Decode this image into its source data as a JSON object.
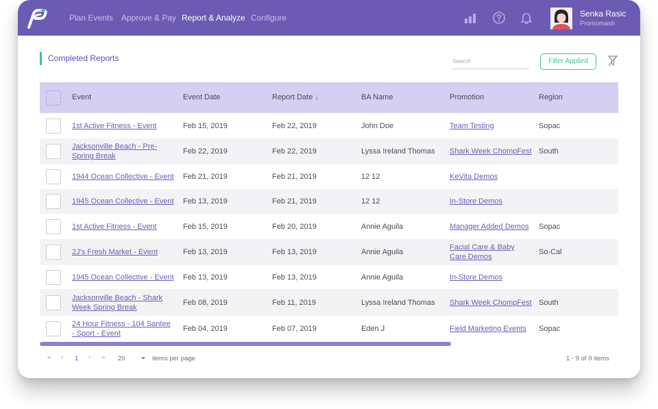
{
  "app": {
    "brand_color": "#6c5bb3",
    "accent_color": "#3cc48e",
    "nav": [
      "Plan Events",
      "Approve & Pay",
      "Report & Analyze",
      "Configure"
    ],
    "active_nav": "Report & Analyze",
    "user": {
      "name": "Senka Rasic",
      "org": "Promomash"
    },
    "icons": [
      "bar-chart-icon",
      "help-icon",
      "bell-icon"
    ]
  },
  "page": {
    "title": "Completed Reports",
    "search_placeholder": "Search",
    "filter_button": "Filter Applied"
  },
  "table": {
    "columns": [
      "Event",
      "Event Date",
      "Report Date",
      "BA Name",
      "Promotion",
      "Region"
    ],
    "sort_indicator": "↓",
    "rows": [
      {
        "event": "1st Active Fitness - Event",
        "event_date": "Feb 15, 2019",
        "report_date": "Feb 22, 2019",
        "ba_name": "John Doe",
        "promotion": "Team Testing",
        "region": "Sopac"
      },
      {
        "event": "Jacksonville Beach - Pre-Spring Break",
        "event_date": "Feb 22, 2019",
        "report_date": "Feb 22, 2019",
        "ba_name": "Lyssa Ireland Thomas",
        "promotion": "Shark Week ChompFest",
        "region": "South"
      },
      {
        "event": "1944 Ocean Collective - Event",
        "event_date": "Feb 21, 2019",
        "report_date": "Feb 21, 2019",
        "ba_name": "12 12",
        "promotion": "KeVita Demos",
        "region": ""
      },
      {
        "event": "1945 Ocean Collective - Event",
        "event_date": "Feb 13, 2019",
        "report_date": "Feb 21, 2019",
        "ba_name": "12 12",
        "promotion": "In-Store Demos",
        "region": ""
      },
      {
        "event": "1st Active Fitness - Event",
        "event_date": "Feb 15, 2019",
        "report_date": "Feb 20, 2019",
        "ba_name": "Annie Aguila",
        "promotion": "Manager Added Demos",
        "region": "Sopac"
      },
      {
        "event": "2J's Fresh Market - Event",
        "event_date": "Feb 13, 2019",
        "report_date": "Feb 13, 2019",
        "ba_name": "Annie Aguila",
        "promotion": "Facial Care & Baby Care Demos",
        "region": "So-Cal"
      },
      {
        "event": "1945 Ocean Collective - Event",
        "event_date": "Feb 13, 2019",
        "report_date": "Feb 13, 2019",
        "ba_name": "Annie Aguila",
        "promotion": "In-Store Demos",
        "region": ""
      },
      {
        "event": "Jacksonville Beach - Shark Week Spring Break",
        "event_date": "Feb 08, 2019",
        "report_date": "Feb 11, 2019",
        "ba_name": "Lyssa Ireland Thomas",
        "promotion": "Shark Week ChompFest",
        "region": "South"
      },
      {
        "event": "24 Hour Fitness - 104 Santee - Sport - Event",
        "event_date": "Feb 04, 2019",
        "report_date": "Feb 07, 2019",
        "ba_name": "Eden J",
        "promotion": "Field Marketing Events",
        "region": "Sopac"
      }
    ]
  },
  "pagination": {
    "first": "«",
    "prev": "‹",
    "current_page": "1",
    "next": "›",
    "last": "»",
    "page_size": "20",
    "page_size_label": "items per page",
    "summary": "1 - 9 of 9 items"
  }
}
